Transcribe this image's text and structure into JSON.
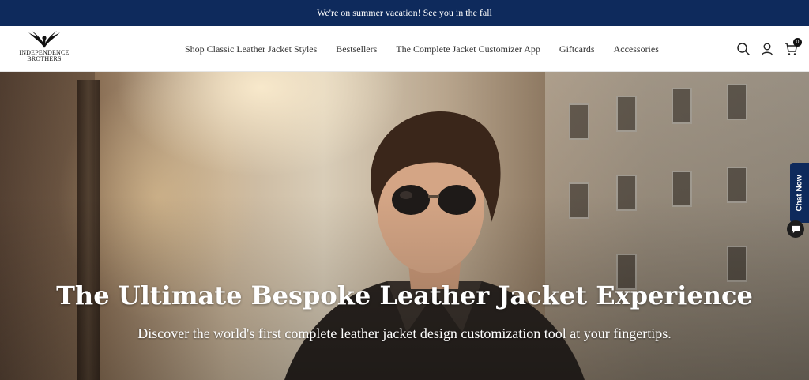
{
  "announcement": {
    "text": "We're on summer vacation! See you in the fall"
  },
  "logo": {
    "line1": "INDEPENDENCE",
    "line2": "BROTHERS"
  },
  "nav": {
    "items": [
      {
        "label": "Shop Classic Leather Jacket Styles"
      },
      {
        "label": "Bestsellers"
      },
      {
        "label": "The Complete Jacket Customizer App"
      },
      {
        "label": "Giftcards"
      },
      {
        "label": "Accessories"
      }
    ]
  },
  "header_icons": {
    "search": "search-icon",
    "account": "user-icon",
    "cart": "cart-icon",
    "cart_count": "0"
  },
  "hero": {
    "title": "The Ultimate Bespoke Leather Jacket Experience",
    "subtitle": "Discover the world's first complete leather jacket design customization tool at your fingertips."
  },
  "chat": {
    "label": "Chat Now"
  },
  "colors": {
    "brand_navy": "#0e2a5c",
    "text_dark": "#333333"
  }
}
